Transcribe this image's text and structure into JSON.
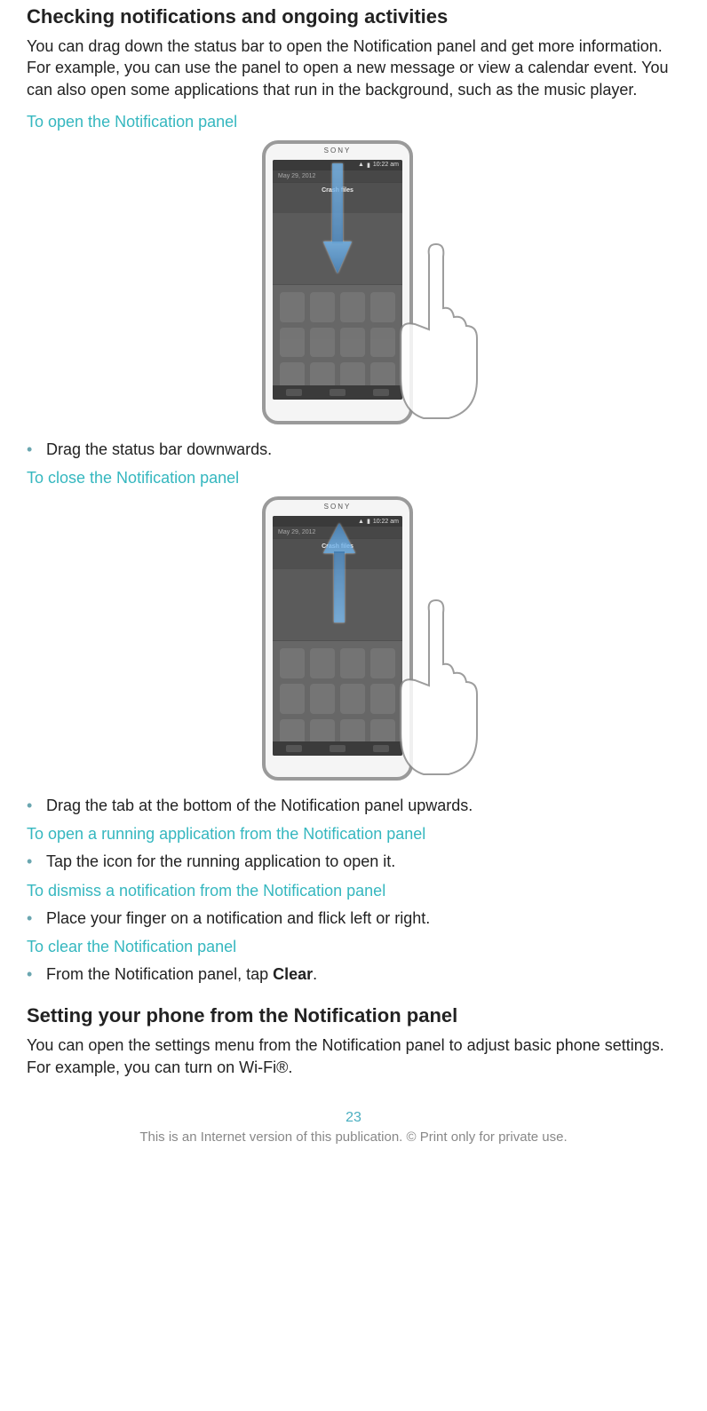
{
  "heading1": "Checking notifications and ongoing activities",
  "intro1": "You can drag down the status bar to open the Notification panel and get more information. For example, you can use the panel to open a new message or view a calendar event. You can also open some applications that run in the background, such as the music player.",
  "sub_open": "To open the Notification panel",
  "bullet_open": "Drag the status bar downwards.",
  "sub_close": "To close the Notification panel",
  "bullet_close": "Drag the tab at the bottom of the Notification panel upwards.",
  "sub_run": "To open a running application from the Notification panel",
  "bullet_run": "Tap the icon for the running application to open it.",
  "sub_dismiss": "To dismiss a notification from the Notification panel",
  "bullet_dismiss": "Place your finger on a notification and flick left or right.",
  "sub_clear": "To clear the Notification panel",
  "bullet_clear_pre": "From the Notification panel, tap ",
  "bullet_clear_bold": "Clear",
  "bullet_clear_post": ".",
  "heading2": "Setting your phone from the Notification panel",
  "intro2": "You can open the settings menu from the Notification panel to adjust basic phone settings. For example, you can turn on Wi-Fi®.",
  "page_number": "23",
  "footer": "This is an Internet version of this publication. © Print only for private use.",
  "phone": {
    "brand": "SONY",
    "date": "May 29, 2012",
    "time": "10:22 am",
    "notif_title": "Crash files"
  }
}
